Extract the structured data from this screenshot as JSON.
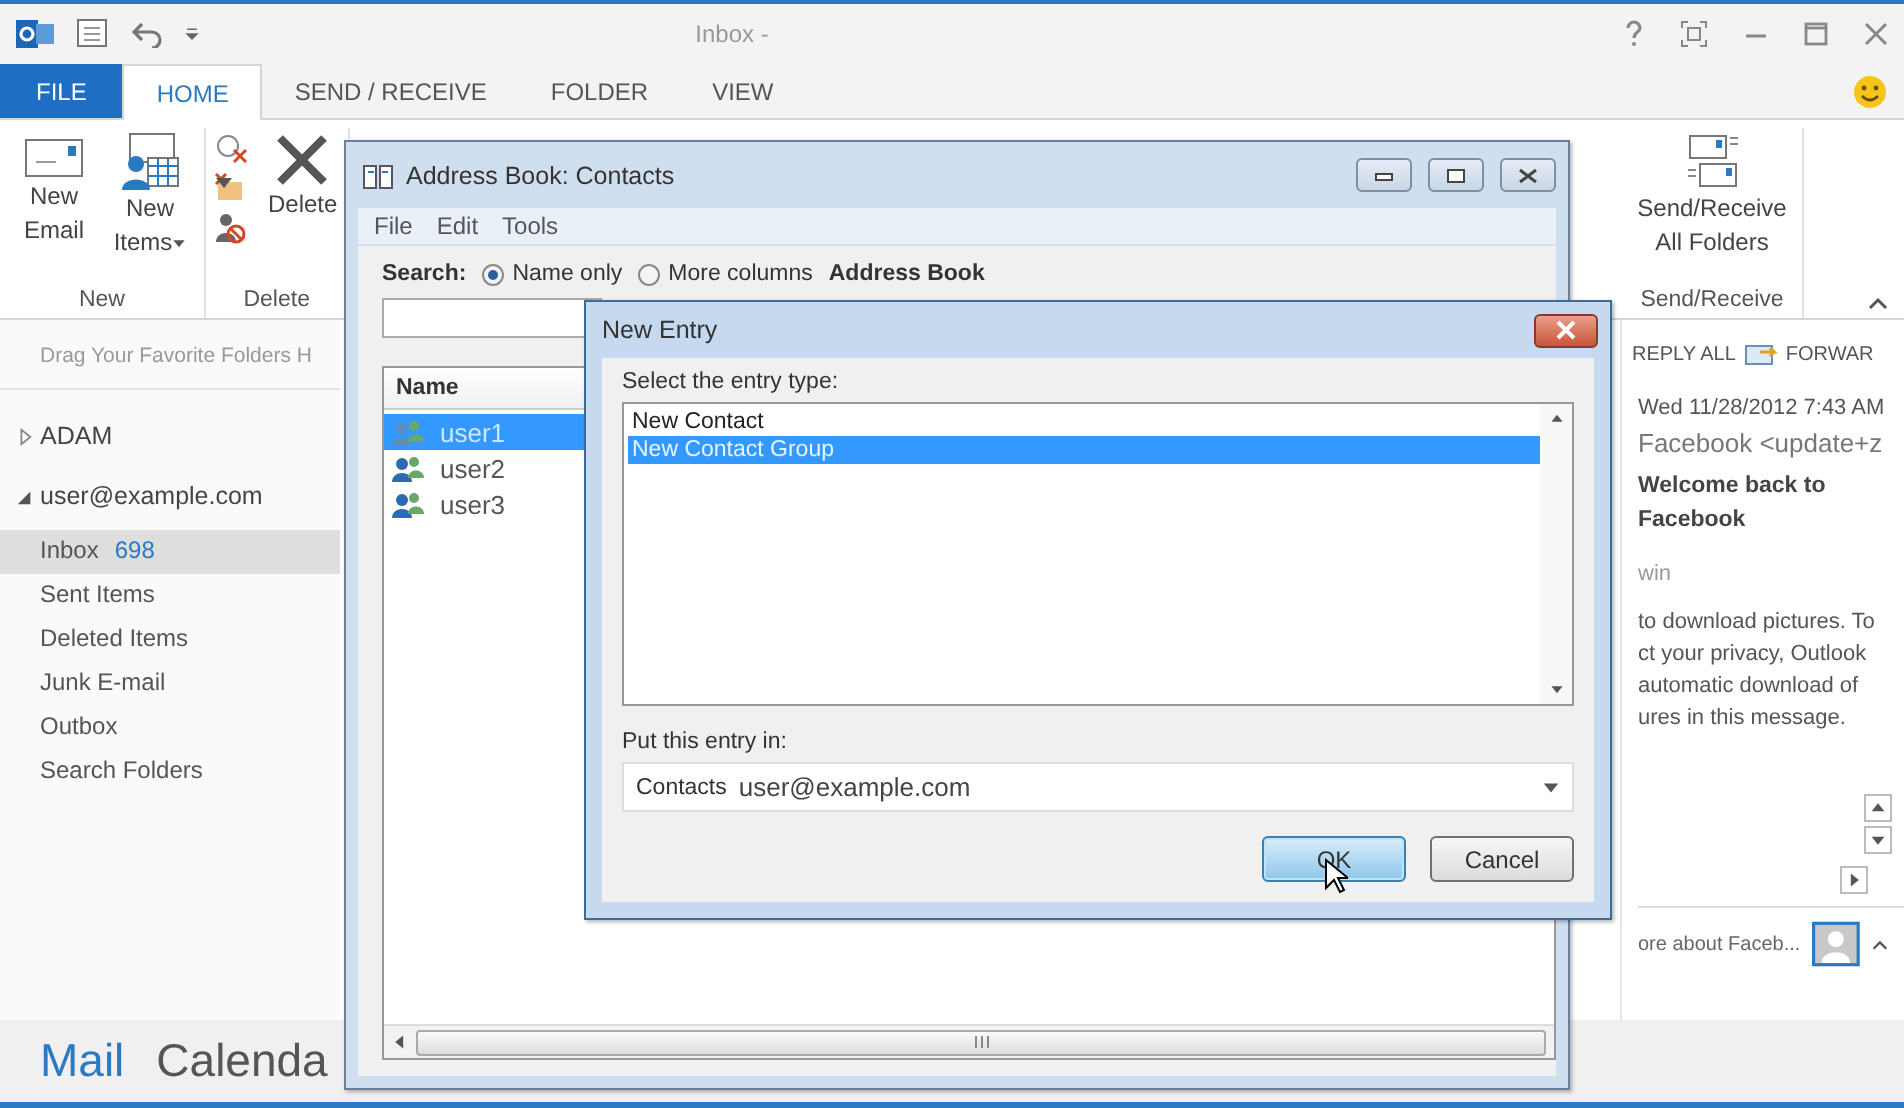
{
  "window": {
    "title": "Inbox -"
  },
  "ribbon_tabs": [
    {
      "label": "FILE",
      "kind": "file",
      "selected": false
    },
    {
      "label": "HOME",
      "kind": "tab",
      "selected": true
    },
    {
      "label": "SEND / RECEIVE",
      "kind": "tab",
      "selected": false
    },
    {
      "label": "FOLDER",
      "kind": "tab",
      "selected": false
    },
    {
      "label": "VIEW",
      "kind": "tab",
      "selected": false
    }
  ],
  "ribbon_groups": [
    {
      "label": "New",
      "buttons": [
        {
          "label": "New Email",
          "kind": "email",
          "dropdown": false
        },
        {
          "label": "New Items",
          "kind": "items",
          "dropdown": true
        }
      ]
    },
    {
      "label": "Delete",
      "buttons": [
        {
          "label": "Delete",
          "kind": "delete",
          "dropdown": false
        }
      ]
    },
    {
      "label": "Send/Receive",
      "buttons": [
        {
          "label": "Send/Receive All Folders",
          "kind": "sendreceive",
          "dropdown": false
        }
      ]
    }
  ],
  "sidebar": {
    "favorites_hint": "Drag Your Favorite Folders H",
    "accounts": [
      {
        "name": "ADAM",
        "expanded": false
      },
      {
        "name": "user@example.com",
        "expanded": true,
        "folders": [
          {
            "name": "Inbox",
            "count": "698",
            "selected": true
          },
          {
            "name": "Sent Items",
            "selected": false
          },
          {
            "name": "Deleted Items",
            "selected": false
          },
          {
            "name": "Junk E-mail",
            "selected": false
          },
          {
            "name": "Outbox",
            "selected": false
          },
          {
            "name": "Search Folders",
            "selected": false
          }
        ]
      }
    ]
  },
  "nav": [
    {
      "label": "Mail",
      "selected": true
    },
    {
      "label": "Calenda",
      "selected": false
    }
  ],
  "reading_pane": {
    "actions": [
      {
        "label": "REPLY ALL",
        "kind": "replyall"
      },
      {
        "label": "FORWAR",
        "kind": "forward"
      }
    ],
    "date": "Wed 11/28/2012 7:43 AM",
    "sender": "Facebook <update+z",
    "subject": "Welcome back to Facebook",
    "to": "win",
    "notice": [
      "to download pictures. To",
      "ct your privacy, Outlook",
      "automatic download of",
      "ures in this message."
    ],
    "people_pane": "ore about Faceb..."
  },
  "address_book": {
    "title": "Address Book: Contacts",
    "menu": [
      "File",
      "Edit",
      "Tools"
    ],
    "search_label": "Search:",
    "search_options": [
      {
        "label": "Name only",
        "selected": true
      },
      {
        "label": "More columns",
        "selected": false
      }
    ],
    "book_label": "Address Book",
    "column": "Name",
    "contacts": [
      {
        "name": "user1",
        "selected": true
      },
      {
        "name": "user2",
        "selected": false
      },
      {
        "name": "user3",
        "selected": false
      }
    ]
  },
  "new_entry": {
    "title": "New Entry",
    "type_label": "Select the entry type:",
    "types": [
      {
        "label": "New Contact",
        "selected": false
      },
      {
        "label": "New Contact Group",
        "selected": true
      }
    ],
    "folder_label": "Put this entry in:",
    "folder_prefix": "Contacts",
    "folder_value": "user@example.com",
    "buttons": [
      {
        "label": "OK",
        "kind": "default"
      },
      {
        "label": "Cancel",
        "kind": "normal"
      }
    ]
  }
}
